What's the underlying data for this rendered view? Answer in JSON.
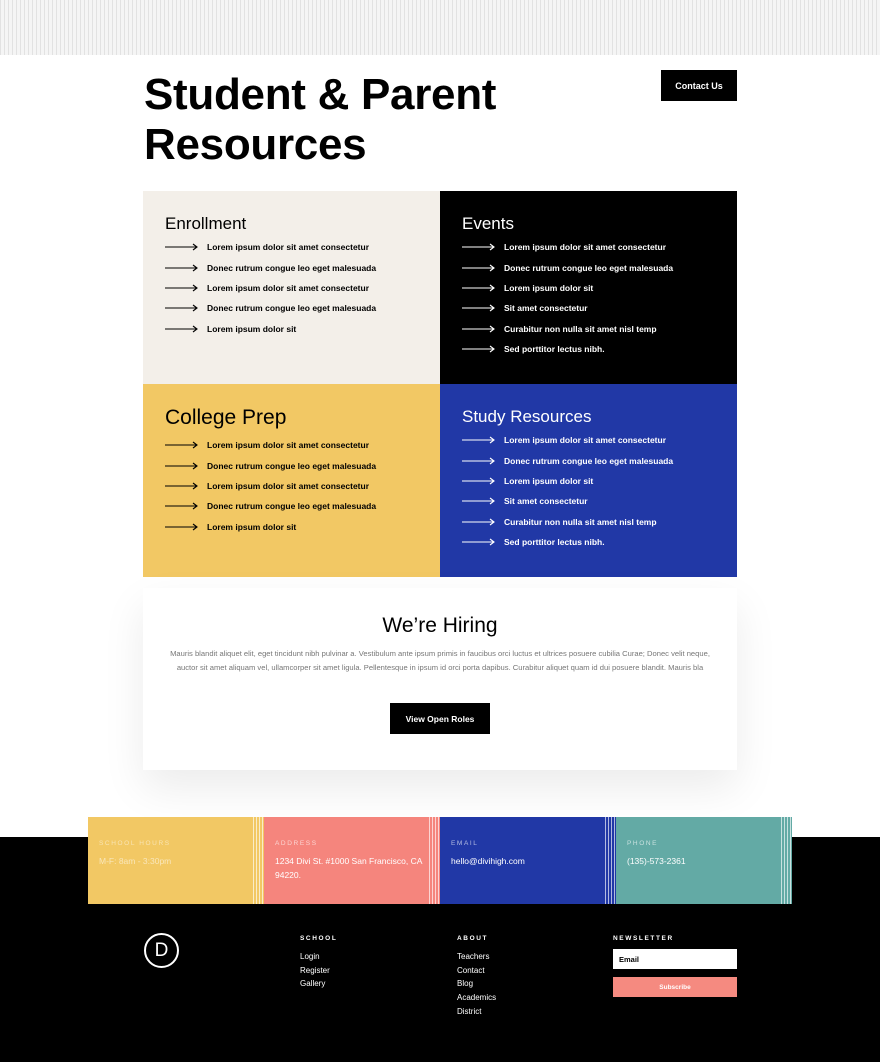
{
  "header": {
    "title": "Student & Parent Resources",
    "contact_label": "Contact Us"
  },
  "resources": [
    {
      "title": "Enrollment",
      "links": [
        "Lorem ipsum dolor sit amet consectetur",
        "Donec rutrum congue leo eget malesuada",
        "Lorem ipsum dolor sit amet consectetur",
        "Donec rutrum congue leo eget malesuada",
        "Lorem ipsum dolor sit"
      ]
    },
    {
      "title": "Events",
      "links": [
        "Lorem ipsum dolor sit amet consectetur",
        "Donec rutrum congue leo eget malesuada",
        "Lorem ipsum dolor sit",
        "Sit amet consectetur",
        "Curabitur non nulla sit amet nisl temp",
        "Sed porttitor lectus nibh."
      ]
    },
    {
      "title": "College Prep",
      "links": [
        "Lorem ipsum dolor sit amet consectetur",
        "Donec rutrum congue leo eget malesuada",
        "Lorem ipsum dolor sit amet consectetur",
        "Donec rutrum congue leo eget malesuada",
        "Lorem ipsum dolor sit"
      ]
    },
    {
      "title": "Study Resources",
      "links": [
        "Lorem ipsum dolor sit amet consectetur",
        "Donec rutrum congue leo eget malesuada",
        "Lorem ipsum dolor sit",
        "Sit amet consectetur",
        "Curabitur non nulla sit amet nisl temp",
        "Sed porttitor lectus nibh."
      ]
    }
  ],
  "hiring": {
    "title": "We’re Hiring",
    "text": "Mauris blandit aliquet elit, eget tincidunt nibh pulvinar a. Vestibulum ante ipsum primis in faucibus orci luctus et ultrices posuere cubilia Curae; Donec velit neque, auctor sit amet aliquam vel, ullamcorper sit amet ligula. Pellentesque in ipsum id orci porta dapibus. Curabitur aliquet quam id dui posuere blandit. Mauris bla",
    "button_label": "View Open Roles"
  },
  "contact_info": [
    {
      "label": "School Hours",
      "value": "M-F: 8am - 3:30pm",
      "color": "#f2c864"
    },
    {
      "label": "Address",
      "value": "1234 Divi St. #1000 San Francisco, CA 94220.",
      "color": "#f5857d"
    },
    {
      "label": "Email",
      "value": "hello@divihigh.com",
      "color": "#2138a6"
    },
    {
      "label": "Phone",
      "value": "(135)-573-2361",
      "color": "#63aaa5"
    }
  ],
  "footer": {
    "logo_letter": "D",
    "columns": [
      {
        "title": "SCHOOL",
        "links": [
          "Login",
          "Register",
          "Gallery"
        ]
      },
      {
        "title": "ABOUT",
        "links": [
          "Teachers",
          "Contact",
          "Blog",
          "Academics",
          "District"
        ]
      }
    ],
    "newsletter": {
      "title": "NEWSLETTER",
      "email_placeholder": "Email",
      "subscribe_label": "Subscribe"
    }
  }
}
